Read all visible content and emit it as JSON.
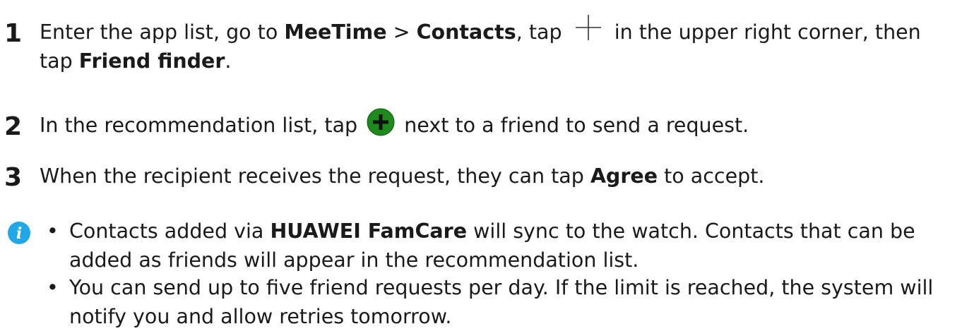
{
  "steps": [
    {
      "number": "1",
      "text_a": "Enter the app list, go to ",
      "bold_a": "MeeTime",
      "text_b": " > ",
      "bold_b": "Contacts",
      "text_c": ", tap ",
      "icon": "plus-icon",
      "text_d": " in the upper right corner, then tap ",
      "bold_c": "Friend finder",
      "text_e": "."
    },
    {
      "number": "2",
      "text_a": "In the recommendation list, tap ",
      "icon": "add-friend-icon",
      "text_b": " next to a friend to send a request."
    },
    {
      "number": "3",
      "text_a": "When the recipient receives the request, they can tap ",
      "bold_a": "Agree",
      "text_b": " to accept."
    }
  ],
  "note": {
    "icon": "info-icon",
    "colors": {
      "info": "#1fa7e8",
      "green": "#1e8a1e"
    },
    "items": [
      {
        "bullet": "•",
        "text_a": "Contacts added via ",
        "bold_a": "HUAWEI FamCare",
        "text_b": " will sync to the watch. Contacts that can be added as friends will appear in the recommendation list."
      },
      {
        "bullet": "•",
        "text_a": "You can send up to five friend requests per day. If the limit is reached, the system will notify you and allow retries tomorrow."
      }
    ]
  }
}
